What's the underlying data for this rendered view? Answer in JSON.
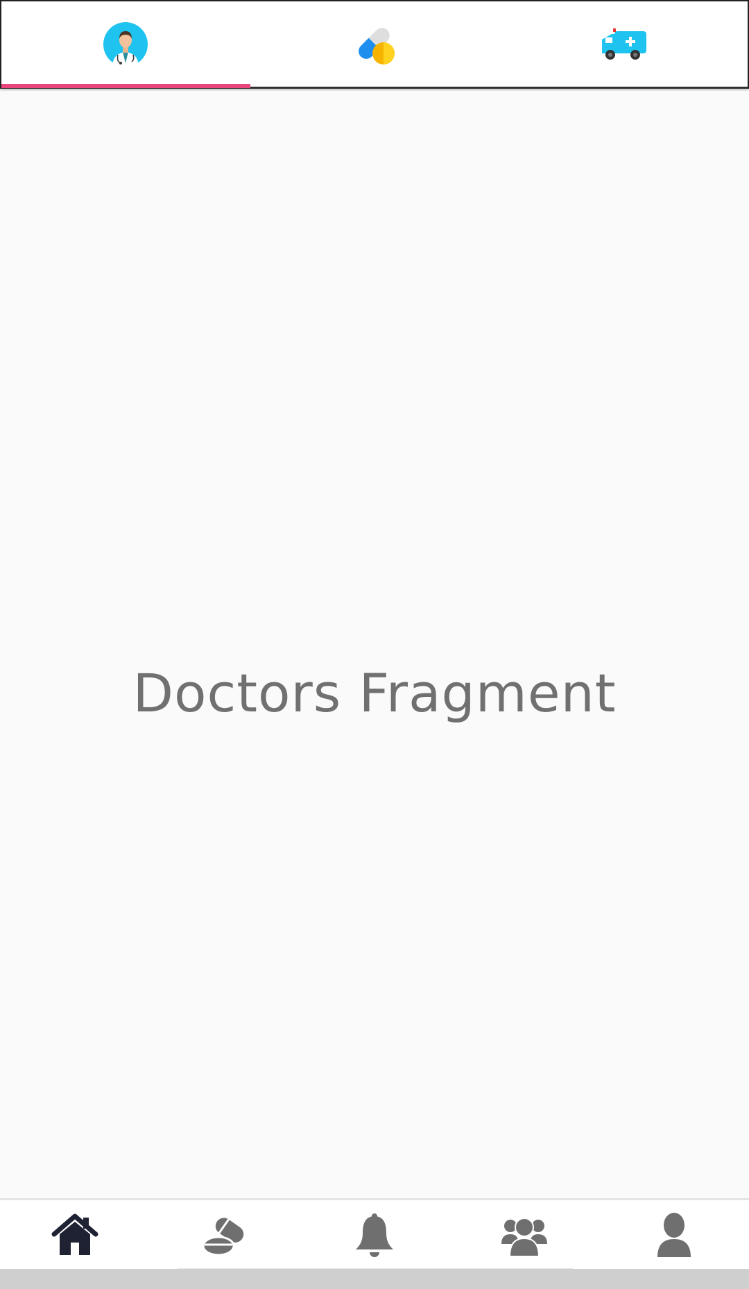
{
  "top_tabs": [
    {
      "name": "doctors",
      "icon": "doctor-avatar-icon",
      "selected": true
    },
    {
      "name": "medicines",
      "icon": "pills-icon",
      "selected": false
    },
    {
      "name": "ambulance",
      "icon": "ambulance-icon",
      "selected": false
    }
  ],
  "colors": {
    "tab_indicator": "#e8457a",
    "active_nav_icon": "#1f2233",
    "inactive_nav_icon": "#6f6f6f",
    "background": "#fafafa",
    "icon_cyan": "#1ec3ef"
  },
  "main": {
    "fragment_label": "Doctors Fragment"
  },
  "bottom_nav": [
    {
      "name": "home",
      "icon": "home-icon",
      "active": true
    },
    {
      "name": "pharmacy",
      "icon": "pill-icon",
      "active": false
    },
    {
      "name": "notifications",
      "icon": "bell-icon",
      "active": false
    },
    {
      "name": "community",
      "icon": "people-icon",
      "active": false
    },
    {
      "name": "profile",
      "icon": "user-icon",
      "active": false
    }
  ]
}
